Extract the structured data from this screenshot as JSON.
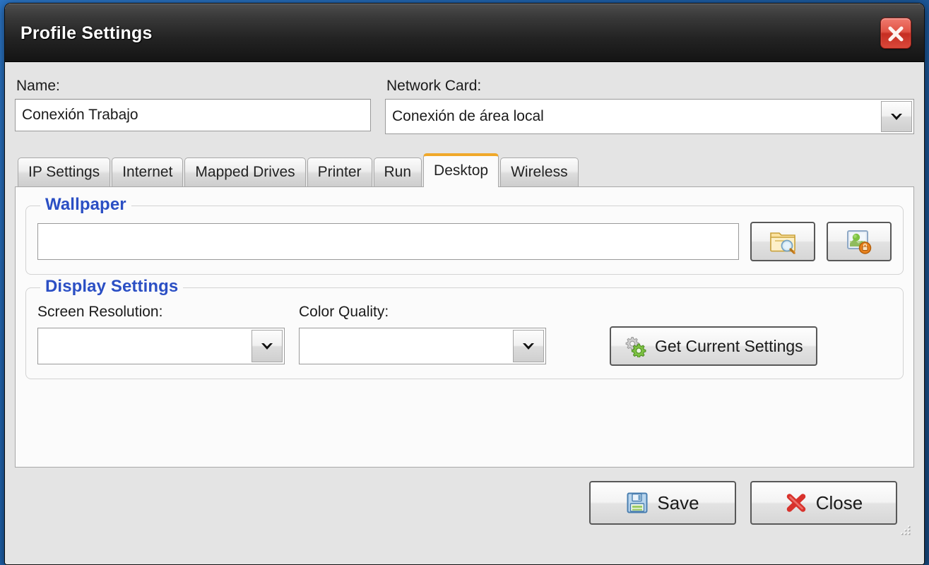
{
  "window": {
    "title": "Profile Settings",
    "close_icon": "close-x-icon"
  },
  "form": {
    "name_label": "Name:",
    "name_value": "Conexión Trabajo",
    "nic_label": "Network Card:",
    "nic_value": "Conexión de área local",
    "nic_dropdown_icon": "chevron-down-icon"
  },
  "tabs": [
    {
      "label": "IP Settings",
      "active": false
    },
    {
      "label": "Internet",
      "active": false
    },
    {
      "label": "Mapped Drives",
      "active": false
    },
    {
      "label": "Printer",
      "active": false
    },
    {
      "label": "Run",
      "active": false
    },
    {
      "label": "Desktop",
      "active": true
    },
    {
      "label": "Wireless",
      "active": false
    }
  ],
  "desktop_tab": {
    "wallpaper": {
      "group_title": "Wallpaper",
      "path_value": "",
      "browse_icon": "folder-search-icon",
      "preview_icon": "picture-lock-icon"
    },
    "display_settings": {
      "group_title": "Display Settings",
      "resolution_label": "Screen Resolution:",
      "resolution_value": "",
      "color_quality_label": "Color Quality:",
      "color_quality_value": "",
      "dropdown_icon": "chevron-down-icon",
      "get_current_label": "Get Current Settings",
      "get_current_icon": "gears-icon"
    }
  },
  "footer": {
    "save_label": "Save",
    "save_icon": "floppy-disk-icon",
    "close_label": "Close",
    "close_icon": "red-x-icon",
    "resize_grip_icon": "resize-grip-icon"
  },
  "colors": {
    "accent_tab": "#f0a82a",
    "group_heading": "#2b4fc4",
    "close_button": "#d9483a",
    "dialog_background": "#e4e4e4",
    "panel_background": "#fbfbfb"
  }
}
